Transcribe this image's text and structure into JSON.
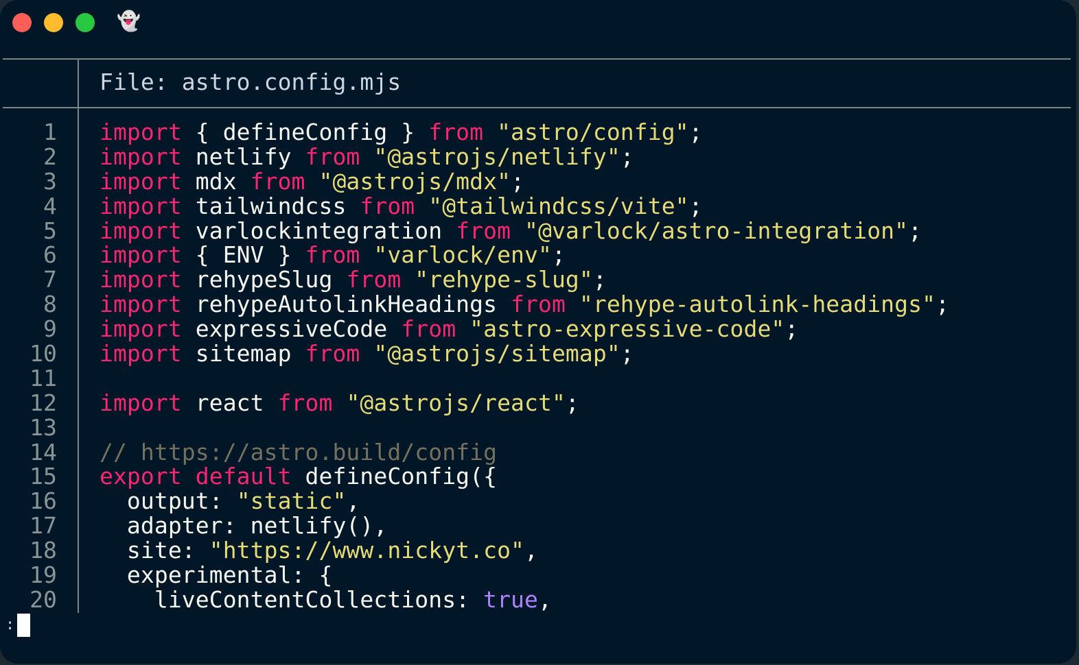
{
  "window": {
    "controls": [
      {
        "name": "close",
        "color": "#ff5f57"
      },
      {
        "name": "minimize",
        "color": "#febc2e"
      },
      {
        "name": "zoom",
        "color": "#28c840"
      }
    ],
    "app_icon": "👻"
  },
  "header": {
    "file_label": "File: astro.config.mjs"
  },
  "colors": {
    "background": "#011627",
    "keyword": "#f92672",
    "string": "#e6db74",
    "comment": "#75715e",
    "boolean": "#ae81ff",
    "text": "#f8f8f2"
  },
  "lines": [
    {
      "n": "1",
      "tokens": [
        [
          "kw",
          "import"
        ],
        [
          "plain",
          " { defineConfig } "
        ],
        [
          "kw",
          "from"
        ],
        [
          "plain",
          " "
        ],
        [
          "str",
          "\"astro/config\""
        ],
        [
          "plain",
          ";"
        ]
      ]
    },
    {
      "n": "2",
      "tokens": [
        [
          "kw",
          "import"
        ],
        [
          "plain",
          " netlify "
        ],
        [
          "kw",
          "from"
        ],
        [
          "plain",
          " "
        ],
        [
          "str",
          "\"@astrojs/netlify\""
        ],
        [
          "plain",
          ";"
        ]
      ]
    },
    {
      "n": "3",
      "tokens": [
        [
          "kw",
          "import"
        ],
        [
          "plain",
          " mdx "
        ],
        [
          "kw",
          "from"
        ],
        [
          "plain",
          " "
        ],
        [
          "str",
          "\"@astrojs/mdx\""
        ],
        [
          "plain",
          ";"
        ]
      ]
    },
    {
      "n": "4",
      "tokens": [
        [
          "kw",
          "import"
        ],
        [
          "plain",
          " tailwindcss "
        ],
        [
          "kw",
          "from"
        ],
        [
          "plain",
          " "
        ],
        [
          "str",
          "\"@tailwindcss/vite\""
        ],
        [
          "plain",
          ";"
        ]
      ]
    },
    {
      "n": "5",
      "tokens": [
        [
          "kw",
          "import"
        ],
        [
          "plain",
          " varlockintegration "
        ],
        [
          "kw",
          "from"
        ],
        [
          "plain",
          " "
        ],
        [
          "str",
          "\"@varlock/astro-integration\""
        ],
        [
          "plain",
          ";"
        ]
      ]
    },
    {
      "n": "6",
      "tokens": [
        [
          "kw",
          "import"
        ],
        [
          "plain",
          " { ENV } "
        ],
        [
          "kw",
          "from"
        ],
        [
          "plain",
          " "
        ],
        [
          "str",
          "\"varlock/env\""
        ],
        [
          "plain",
          ";"
        ]
      ]
    },
    {
      "n": "7",
      "tokens": [
        [
          "kw",
          "import"
        ],
        [
          "plain",
          " rehypeSlug "
        ],
        [
          "kw",
          "from"
        ],
        [
          "plain",
          " "
        ],
        [
          "str",
          "\"rehype-slug\""
        ],
        [
          "plain",
          ";"
        ]
      ]
    },
    {
      "n": "8",
      "tokens": [
        [
          "kw",
          "import"
        ],
        [
          "plain",
          " rehypeAutolinkHeadings "
        ],
        [
          "kw",
          "from"
        ],
        [
          "plain",
          " "
        ],
        [
          "str",
          "\"rehype-autolink-headings\""
        ],
        [
          "plain",
          ";"
        ]
      ]
    },
    {
      "n": "9",
      "tokens": [
        [
          "kw",
          "import"
        ],
        [
          "plain",
          " expressiveCode "
        ],
        [
          "kw",
          "from"
        ],
        [
          "plain",
          " "
        ],
        [
          "str",
          "\"astro-expressive-code\""
        ],
        [
          "plain",
          ";"
        ]
      ]
    },
    {
      "n": "10",
      "tokens": [
        [
          "kw",
          "import"
        ],
        [
          "plain",
          " sitemap "
        ],
        [
          "kw",
          "from"
        ],
        [
          "plain",
          " "
        ],
        [
          "str",
          "\"@astrojs/sitemap\""
        ],
        [
          "plain",
          ";"
        ]
      ]
    },
    {
      "n": "11",
      "tokens": []
    },
    {
      "n": "12",
      "tokens": [
        [
          "kw",
          "import"
        ],
        [
          "plain",
          " react "
        ],
        [
          "kw",
          "from"
        ],
        [
          "plain",
          " "
        ],
        [
          "str",
          "\"@astrojs/react\""
        ],
        [
          "plain",
          ";"
        ]
      ]
    },
    {
      "n": "13",
      "tokens": []
    },
    {
      "n": "14",
      "tokens": [
        [
          "cm",
          "// https://astro.build/config"
        ]
      ]
    },
    {
      "n": "15",
      "tokens": [
        [
          "kw",
          "export"
        ],
        [
          "plain",
          " "
        ],
        [
          "kw",
          "default"
        ],
        [
          "plain",
          " defineConfig({"
        ]
      ]
    },
    {
      "n": "16",
      "tokens": [
        [
          "plain",
          "  output: "
        ],
        [
          "str",
          "\"static\""
        ],
        [
          "plain",
          ","
        ]
      ]
    },
    {
      "n": "17",
      "tokens": [
        [
          "plain",
          "  adapter: netlify(),"
        ]
      ]
    },
    {
      "n": "18",
      "tokens": [
        [
          "plain",
          "  site: "
        ],
        [
          "str",
          "\"https://www.nickyt.co\""
        ],
        [
          "plain",
          ","
        ]
      ]
    },
    {
      "n": "19",
      "tokens": [
        [
          "plain",
          "  experimental: {"
        ]
      ]
    },
    {
      "n": "20",
      "tokens": [
        [
          "plain",
          "    liveContentCollections: "
        ],
        [
          "bool",
          "true"
        ],
        [
          "plain",
          ","
        ]
      ]
    }
  ],
  "prompt": ":"
}
